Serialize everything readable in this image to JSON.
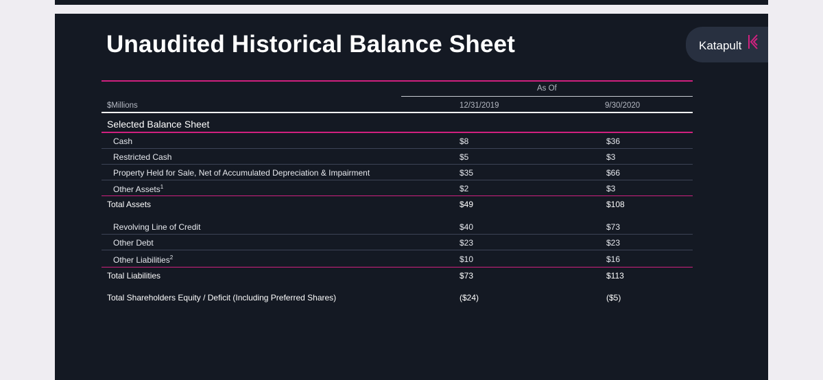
{
  "slide": {
    "title": "Unaudited Historical Balance Sheet",
    "logo_text": "Katapult"
  },
  "table": {
    "units_label": "$Millions",
    "group_header": "As Of",
    "columns": [
      "12/31/2019",
      "9/30/2020"
    ],
    "section_title": "Selected Balance Sheet",
    "rows": [
      {
        "label": "Cash",
        "sup": "",
        "values": [
          "$8",
          "$36"
        ]
      },
      {
        "label": "Restricted Cash",
        "sup": "",
        "values": [
          "$5",
          "$3"
        ]
      },
      {
        "label": "Property Held for Sale, Net of Accumulated Depreciation & Impairment",
        "sup": "",
        "values": [
          "$35",
          "$66"
        ]
      },
      {
        "label": "Other Assets",
        "sup": "1",
        "values": [
          "$2",
          "$3"
        ]
      },
      {
        "label": "Total Assets",
        "sup": "",
        "values": [
          "$49",
          "$108"
        ]
      },
      {
        "label": "Revolving Line of Credit",
        "sup": "",
        "values": [
          "$40",
          "$73"
        ]
      },
      {
        "label": "Other Debt",
        "sup": "",
        "values": [
          "$23",
          "$23"
        ]
      },
      {
        "label": "Other Liabilities",
        "sup": "2",
        "values": [
          "$10",
          "$16"
        ]
      },
      {
        "label": "Total Liabilities",
        "sup": "",
        "values": [
          "$73",
          "$113"
        ]
      },
      {
        "label": "Total Shareholders Equity / Deficit (Including Preferred Shares)",
        "sup": "",
        "values": [
          "($24)",
          "($5)"
        ]
      }
    ]
  },
  "colors": {
    "background": "#141923",
    "accent_pink": "#d0217f",
    "text": "#ffffff"
  }
}
